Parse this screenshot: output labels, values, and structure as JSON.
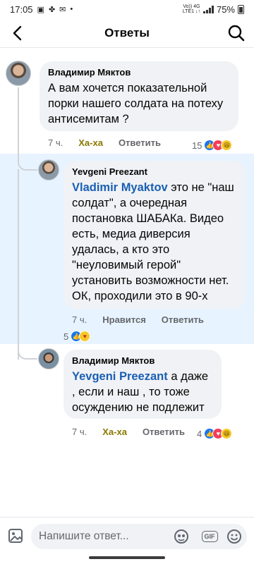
{
  "status_bar": {
    "time": "17:05",
    "network_top": "Vo)) 4G",
    "network_bottom": "LTE1 ↓↑",
    "battery": "75%"
  },
  "header": {
    "title": "Ответы"
  },
  "comments": [
    {
      "author": "Владимир Мяктов",
      "text": "А вам хочется показательной порки нашего солдата на потеху антисемитам ?",
      "time": "7 ч.",
      "reaction_label": "Ха-ха",
      "reply_label": "Ответить",
      "reaction_count": "15"
    },
    {
      "author": "Yevgeni Preezant",
      "mention": "Vladimir Myaktov",
      "text": " это не \"наш солдат\", а очередная постановка ШАБАКа. Видео есть, медиа диверсия удалась, а кто это \"неуловимый герой\" установить возможности нет. ОК, проходили это в 90-х",
      "time": "7 ч.",
      "reaction_label": "Нравится",
      "reply_label": "Ответить",
      "reaction_count": "5"
    },
    {
      "author": "Владимир Мяктов",
      "mention": "Yevgeni Preezant",
      "text": " а даже , если и наш , то тоже осуждению не подлежит",
      "time": "7 ч.",
      "reaction_label": "Ха-ха",
      "reply_label": "Ответить",
      "reaction_count": "4"
    }
  ],
  "composer": {
    "placeholder": "Напишите ответ...",
    "gif_label": "GIF"
  },
  "colors": {
    "highlight": "#e7f3ff",
    "mention": "#1a5fb4",
    "haha": "#8a7800",
    "like": "#1877f2",
    "love": "#f33e58"
  }
}
